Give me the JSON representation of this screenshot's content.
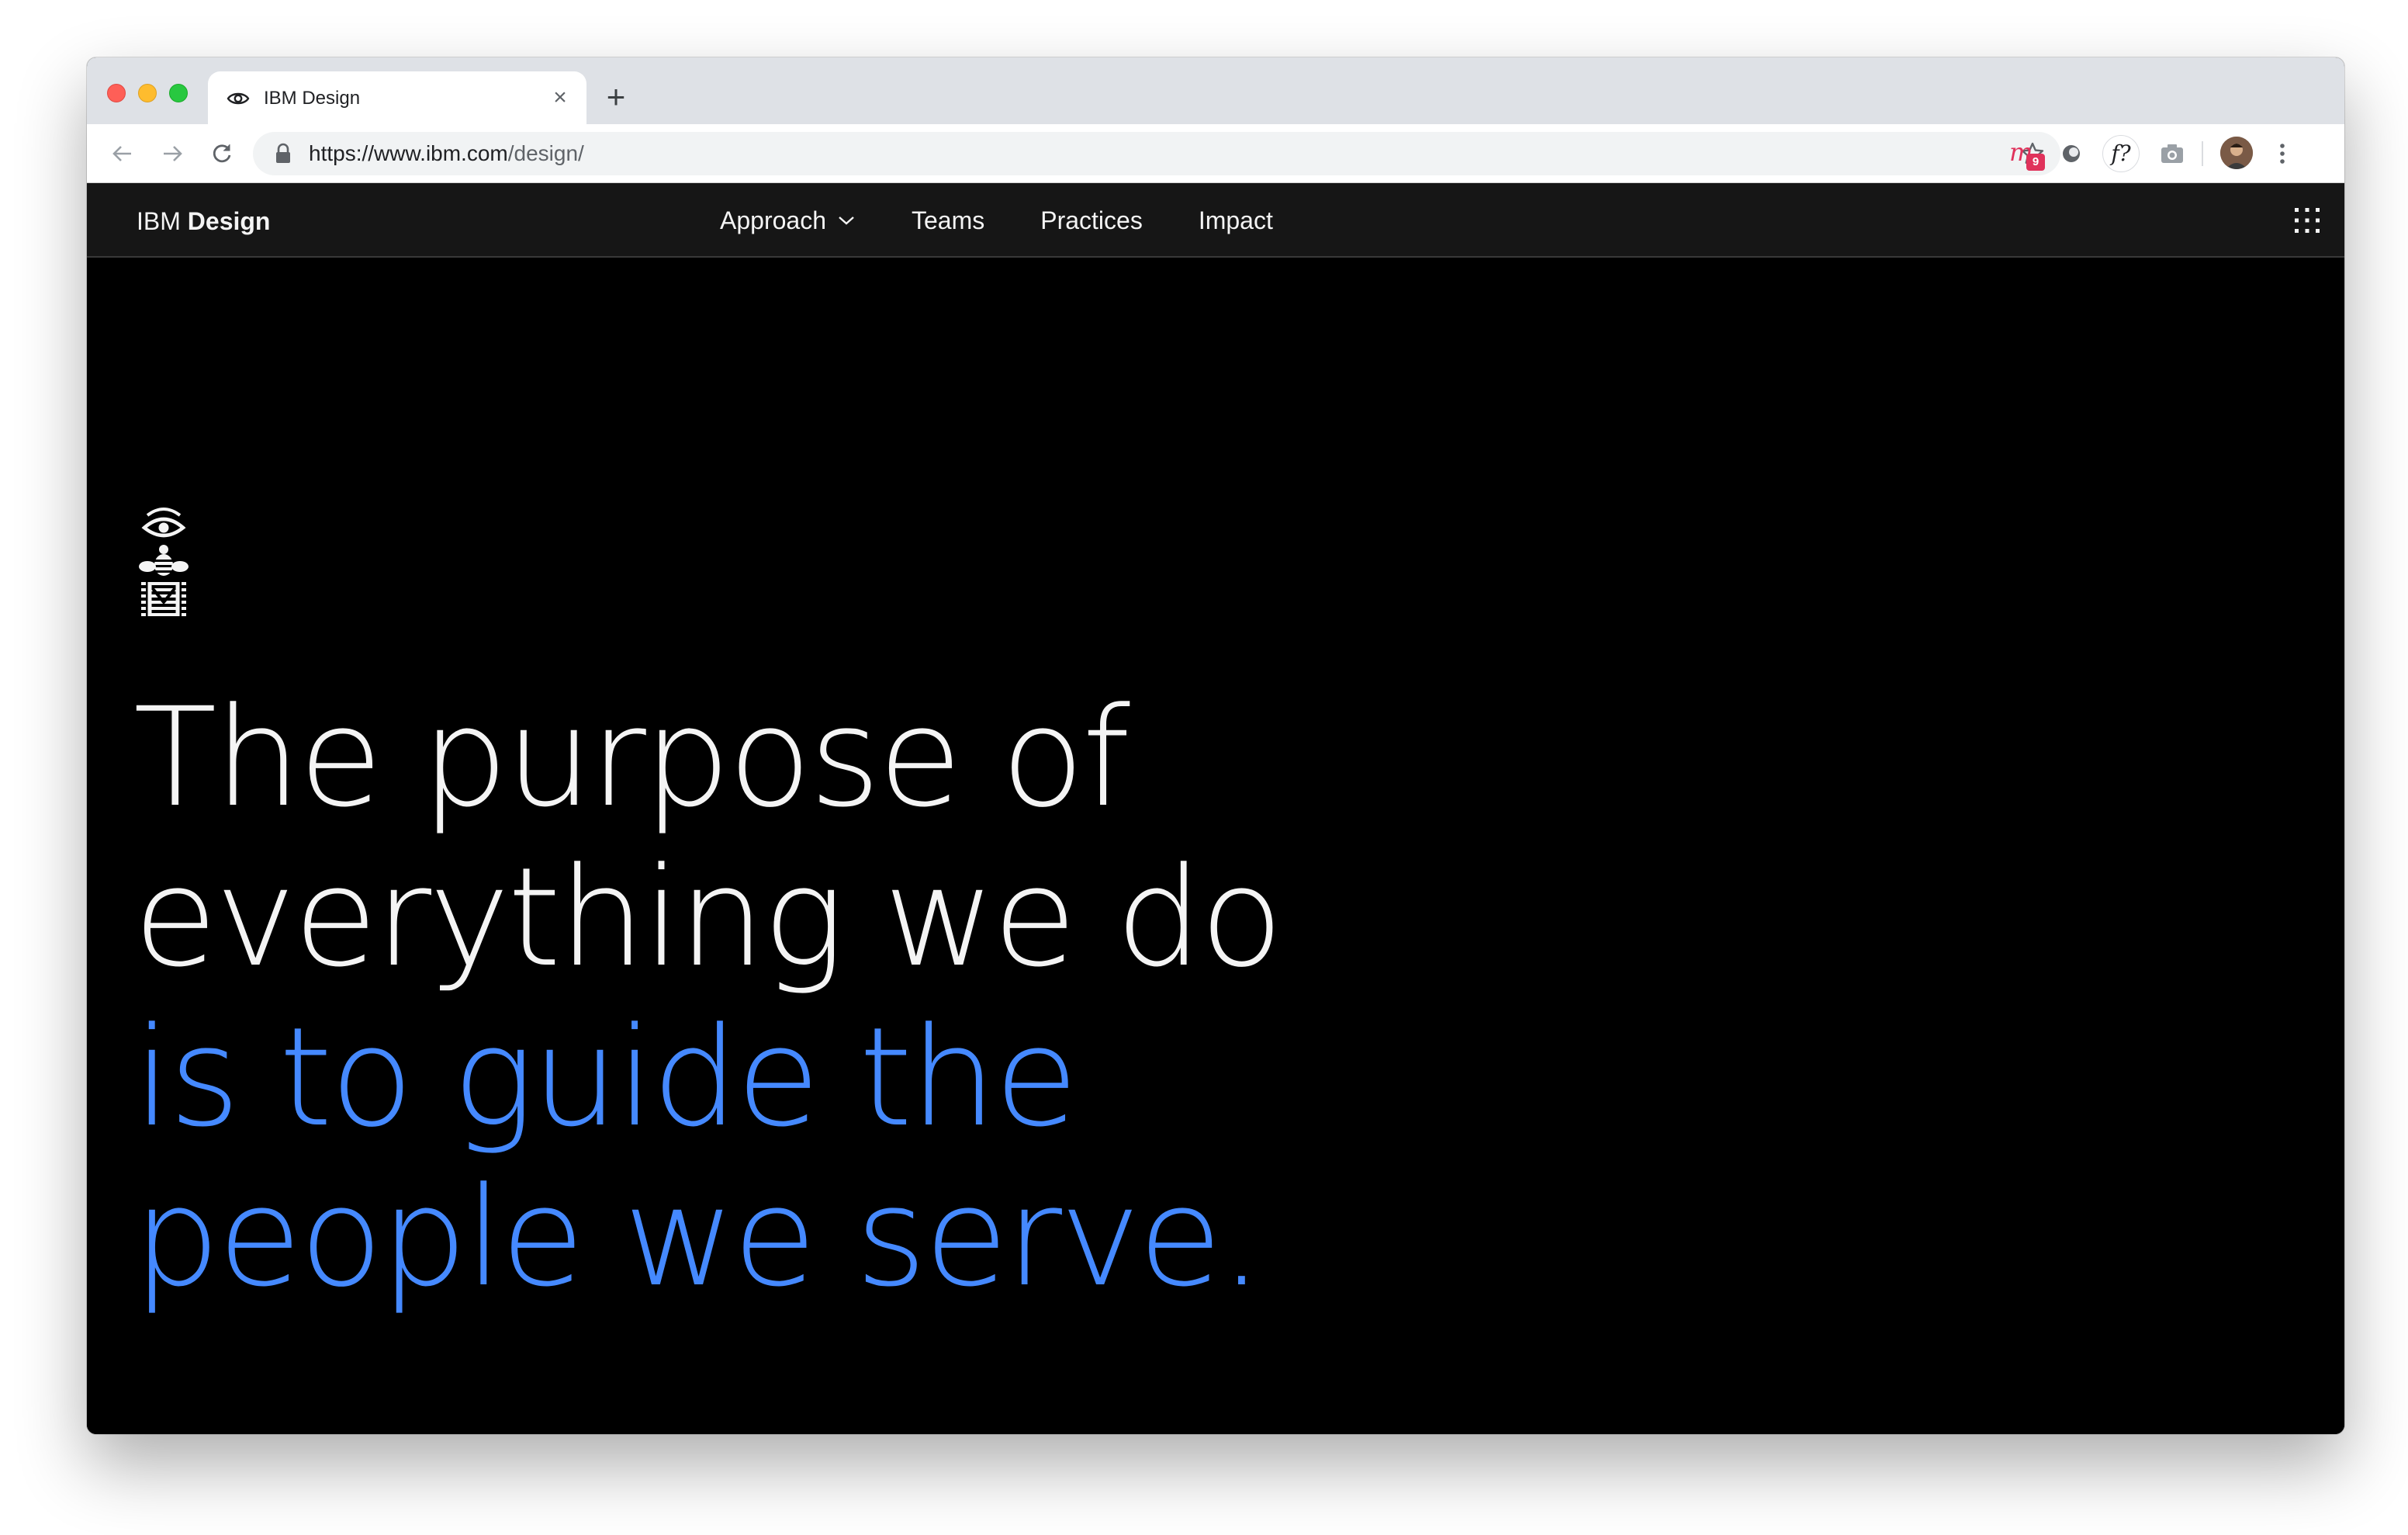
{
  "browser": {
    "tab": {
      "title": "IBM Design",
      "icon": "eye-icon"
    },
    "new_tab_label": "+",
    "url": {
      "scheme_host": "https://www.ibm.com",
      "path": "/design/"
    },
    "extension_badge": "9",
    "extension_f_label": "f?"
  },
  "masthead": {
    "brand_prefix": "IBM",
    "brand_name": "Design",
    "nav": [
      "Approach",
      "Teams",
      "Practices",
      "Impact"
    ]
  },
  "hero": {
    "lines_white": [
      "The purpose of",
      "everything we do"
    ],
    "lines_blue": [
      "is to guide the",
      "people we serve."
    ]
  },
  "colors": {
    "accent_blue": "#4589ff",
    "masthead_bg": "#161616",
    "page_bg": "#000000"
  }
}
